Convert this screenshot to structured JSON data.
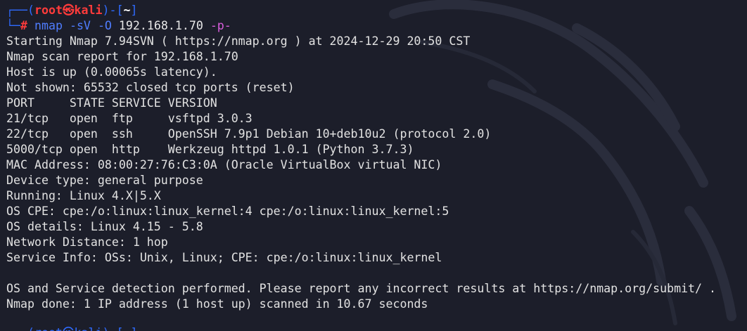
{
  "prompt": {
    "line1_left": "┌──(",
    "user": "root",
    "at": "㉿",
    "host": "kali",
    "mid": ")-[",
    "cwd": "~",
    "end": "]",
    "line2_left": "└─",
    "hash": "#"
  },
  "command": {
    "program": "nmap",
    "flag1": "-sV",
    "flag2": "-O",
    "target": "192.168.1.70",
    "flag3": "-p-"
  },
  "output": [
    "Starting Nmap 7.94SVN ( https://nmap.org ) at 2024-12-29 20:50 CST",
    "Nmap scan report for 192.168.1.70",
    "Host is up (0.00065s latency).",
    "Not shown: 65532 closed tcp ports (reset)",
    "PORT     STATE SERVICE VERSION",
    "21/tcp   open  ftp     vsftpd 3.0.3",
    "22/tcp   open  ssh     OpenSSH 7.9p1 Debian 10+deb10u2 (protocol 2.0)",
    "5000/tcp open  http    Werkzeug httpd 1.0.1 (Python 3.7.3)",
    "MAC Address: 08:00:27:76:C3:0A (Oracle VirtualBox virtual NIC)",
    "Device type: general purpose",
    "Running: Linux 4.X|5.X",
    "OS CPE: cpe:/o:linux:linux_kernel:4 cpe:/o:linux:linux_kernel:5",
    "OS details: Linux 4.15 - 5.8",
    "Network Distance: 1 hop",
    "Service Info: OSs: Unix, Linux; CPE: cpe:/o:linux:linux_kernel",
    "",
    "OS and Service detection performed. Please report any incorrect results at https://nmap.org/submit/ .",
    "Nmap done: 1 IP address (1 host up) scanned in 10.67 seconds"
  ],
  "next_prompt_partial": "┌──(root㉿kali)-[~]",
  "colors": {
    "background": "#1c1e2a",
    "prompt_frame": "#2f6bff",
    "prompt_user": "#ff3b3b",
    "command": "#4f7dff",
    "text": "#e2e2e2"
  }
}
